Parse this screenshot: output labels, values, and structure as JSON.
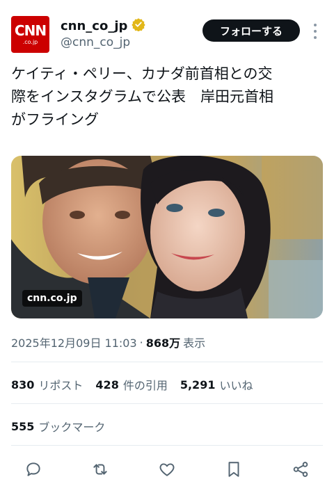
{
  "header": {
    "avatar_logo": "CNN",
    "avatar_sub": ".co.jp",
    "display_name": "cnn_co_jp",
    "handle": "@cnn_co_jp",
    "verified_icon": "verified-badge-icon",
    "follow_label": "フォローする",
    "more_icon": "more-vertical-icon"
  },
  "tweet": {
    "text": "ケイティ・ペリー、カナダ前首相との交\n際をインスタグラムで公表　岸田元首相\nがフライング",
    "media_badge": "cnn.co.jp",
    "timestamp": "2025年12月09日 11:03",
    "separator": "·",
    "views_count": "868万",
    "views_label": "表示"
  },
  "stats": {
    "reposts_count": "830",
    "reposts_label": "リポスト",
    "quotes_count": "428",
    "quotes_label": "件の引用",
    "likes_count": "5,291",
    "likes_label": "いいね",
    "bookmarks_count": "555",
    "bookmarks_label": "ブックマーク"
  },
  "actions": {
    "reply_icon": "reply-icon",
    "repost_icon": "repost-icon",
    "like_icon": "like-icon",
    "bookmark_icon": "bookmark-icon",
    "share_icon": "share-icon"
  },
  "colors": {
    "brand_red": "#cc0000",
    "verified_gold": "#e2b719",
    "text_primary": "#0f1419",
    "text_secondary": "#536471",
    "follow_bg": "#0f1419"
  }
}
